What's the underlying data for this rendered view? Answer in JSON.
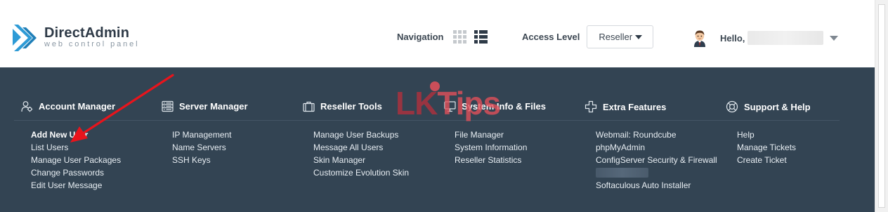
{
  "header": {
    "logo": {
      "title": "DirectAdmin",
      "subtitle": "web control panel"
    },
    "navigation_label": "Navigation",
    "access_level_label": "Access Level",
    "access_level_value": "Reseller",
    "hello_label": "Hello,"
  },
  "menu": {
    "columns": [
      {
        "title": "Account Manager",
        "icon": "account-manager-icon",
        "links": [
          "Add New User",
          "List Users",
          "Manage User Packages",
          "Change Passwords",
          "Edit User Message"
        ]
      },
      {
        "title": "Server Manager",
        "icon": "server-manager-icon",
        "links": [
          "IP Management",
          "Name Servers",
          "SSH Keys"
        ]
      },
      {
        "title": "Reseller Tools",
        "icon": "briefcase-icon",
        "links": [
          "Manage User Backups",
          "Message All Users",
          "Skin Manager",
          "Customize Evolution Skin"
        ]
      },
      {
        "title": "System Info & Files",
        "icon": "system-info-icon",
        "links": [
          "File Manager",
          "System Information",
          "Reseller Statistics"
        ]
      },
      {
        "title": "Extra Features",
        "icon": "puzzle-icon",
        "links": [
          "Webmail: Roundcube",
          "phpMyAdmin",
          "ConfigServer Security & Firewall",
          "Softaculous Auto Installer"
        ]
      },
      {
        "title": "Support & Help",
        "icon": "lifebuoy-icon",
        "links": [
          "Help",
          "Manage Tickets",
          "Create Ticket"
        ]
      }
    ]
  },
  "watermark": {
    "part1": "LK",
    "part2": "Tips"
  },
  "colors": {
    "menu_bg": "#334453",
    "accent": "#2e9bd6",
    "annotation_arrow": "#e8141c"
  }
}
